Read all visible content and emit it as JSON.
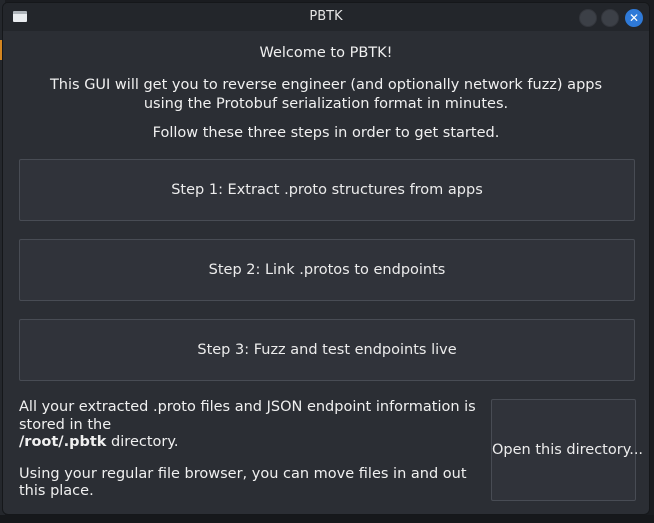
{
  "window": {
    "title": "PBTK"
  },
  "main": {
    "welcome": "Welcome to PBTK!",
    "intro": "This GUI will get you to reverse engineer (and optionally network fuzz) apps using the Protobuf serialization format in minutes.",
    "follow": "Follow these three steps in order to get started."
  },
  "steps": [
    {
      "label": "Step 1: Extract .proto structures from apps"
    },
    {
      "label": "Step 2: Link .protos to endpoints"
    },
    {
      "label": "Step 3: Fuzz and test endpoints live"
    }
  ],
  "info": {
    "text_before_dir": "All your extracted .proto files and JSON endpoint information is stored in the",
    "directory": "/root/.pbtk",
    "text_after_dir": " directory.",
    "text2": "Using your regular file browser, you can move files in and out this place."
  },
  "open_button": {
    "label": "Open this directory..."
  },
  "icons": {
    "app": "window-icon",
    "close": "close-icon"
  },
  "colors": {
    "background": "#2b2e34",
    "close_accent": "#2f7ad8"
  }
}
